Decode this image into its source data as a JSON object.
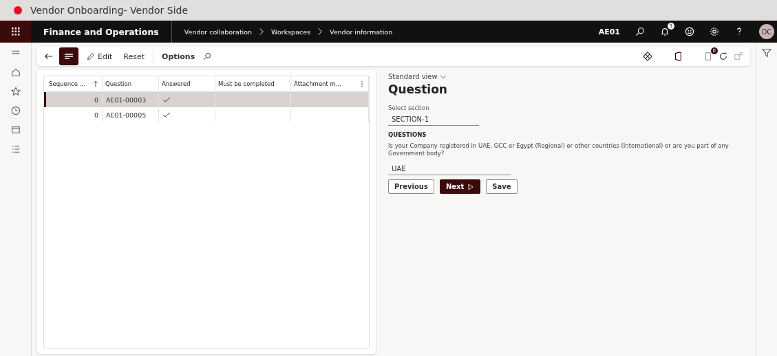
{
  "window": {
    "title": "Vendor Onboarding- Vendor Side"
  },
  "navbar": {
    "app_name": "Finance and Operations",
    "breadcrumb": [
      "Vendor collaboration",
      "Workspaces",
      "Vendor information"
    ],
    "company": "AE01",
    "notification_count": "3",
    "avatar": "DC"
  },
  "toolbar": {
    "buttons": [
      {
        "label": "Edit",
        "kind": "edit"
      },
      {
        "label": "Reset",
        "kind": "plain"
      },
      {
        "label": "Options",
        "kind": "bold"
      }
    ],
    "attachment_count": "0"
  },
  "table": {
    "columns": [
      "Sequence ...",
      "Question",
      "Answered",
      "Must be completed",
      "Attachment m..."
    ],
    "rows": [
      {
        "sequence": "0",
        "question": "AE01-00003",
        "answered": true,
        "selected": true
      },
      {
        "sequence": "0",
        "question": "AE01-00005",
        "answered": true,
        "selected": false
      }
    ]
  },
  "details": {
    "view": "Standard view",
    "title": "Question",
    "section_label": "Select section",
    "section_value": "SECTION-1",
    "questions_heading": "QUESTIONS",
    "question_text": "Is your Company registered in UAE, GCC or Egypt (Regional) or other countries (International) or are you part of any Government body?",
    "answer": "UAE",
    "buttons": [
      {
        "label": "Previous",
        "kind": "secondary"
      },
      {
        "label": "Next",
        "kind": "primary"
      },
      {
        "label": "Save",
        "kind": "secondary"
      }
    ]
  }
}
